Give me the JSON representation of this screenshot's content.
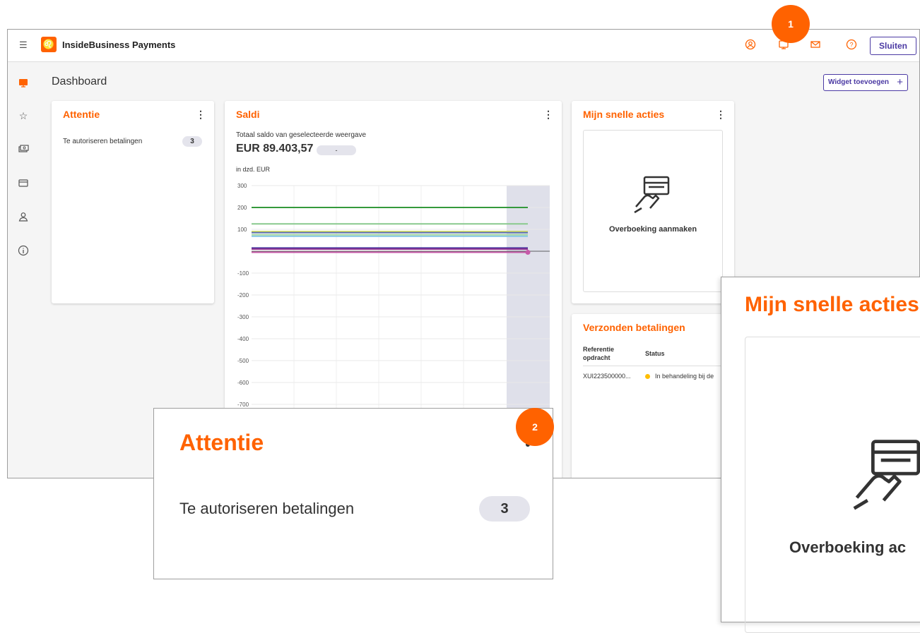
{
  "app": {
    "title": "InsideBusiness Payments",
    "close_label": "Sluiten"
  },
  "page": {
    "title": "Dashboard",
    "add_widget_label": "Widget toevoegen"
  },
  "widgets": {
    "attention": {
      "title": "Attentie",
      "item_label": "Te autoriseren betalingen",
      "item_count": "3"
    },
    "balances": {
      "title": "Saldi",
      "subtitle": "Totaal saldo van geselecteerde weergave",
      "amount": "EUR 89.403,57",
      "change": "-",
      "unit": "in dzd. EUR"
    },
    "quick_actions": {
      "title": "Mijn snelle acties",
      "action_label": "Overboeking aanmaken"
    },
    "sent_payments": {
      "title": "Verzonden betalingen",
      "col_reference": "Referentie opdracht",
      "col_status": "Status",
      "row_reference": "XUI223500000...",
      "row_status": "In behandeling bij de"
    }
  },
  "zoom_attention": {
    "title": "Attentie",
    "item_label": "Te autoriseren betalingen",
    "item_count": "3"
  },
  "zoom_quick_actions": {
    "title": "Mijn snelle acties",
    "action_label": "Overboeking ac"
  },
  "callouts": {
    "one": "1",
    "two": "2"
  },
  "colors": {
    "brand_orange": "#ff6200",
    "accent_purple": "#4b3aa3",
    "status_yellow": "#ffbe00"
  },
  "chart_data": {
    "type": "line",
    "ylabel": "in dzd. EUR",
    "ylim": [
      -700,
      300
    ],
    "yticks": [
      300,
      200,
      100,
      -100,
      -200,
      -300,
      -400,
      -500,
      -600,
      -700
    ],
    "grid": true,
    "series": [
      {
        "color": "#349a3c",
        "values": [
          200,
          200
        ]
      },
      {
        "color": "#89c98d",
        "values": [
          125,
          125
        ]
      },
      {
        "color": "#d4e157",
        "values": [
          90,
          90
        ]
      },
      {
        "color": "#5b6fb5",
        "values": [
          85,
          85
        ]
      },
      {
        "color": "#a0d6a0",
        "values": [
          75,
          75
        ]
      },
      {
        "color": "#8cc9e8",
        "values": [
          68,
          68
        ]
      },
      {
        "color": "#4a3aa0",
        "values": [
          15,
          15
        ]
      },
      {
        "color": "#8a2c8e",
        "values": [
          10,
          10
        ]
      },
      {
        "color": "#c65aa8",
        "values": [
          -5,
          -5
        ]
      }
    ]
  }
}
